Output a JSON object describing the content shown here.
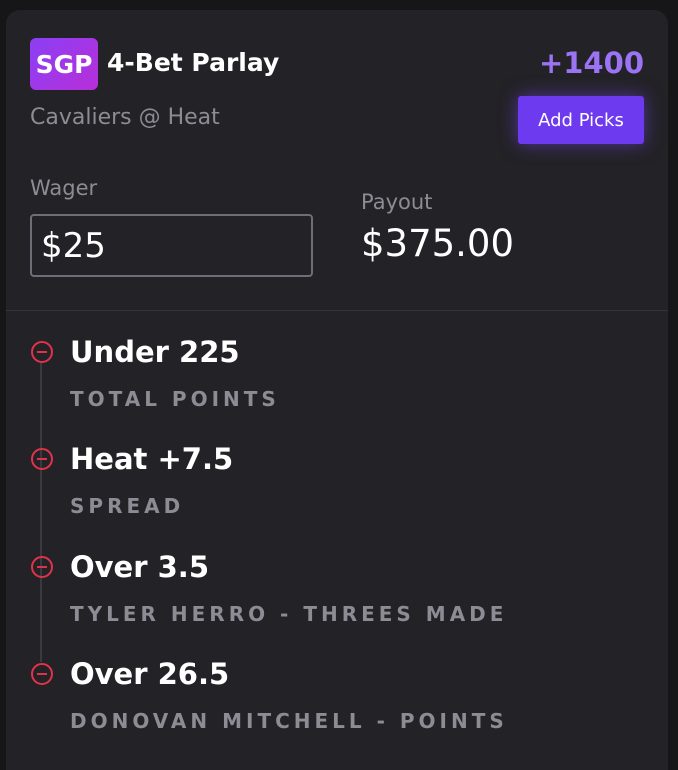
{
  "bet": {
    "badge": "SGP",
    "title": "4-Bet Parlay",
    "matchup": "Cavaliers @ Heat",
    "odds": "+1400",
    "add_picks_label": "Add Picks"
  },
  "wager": {
    "label": "Wager",
    "value": "$25"
  },
  "payout": {
    "label": "Payout",
    "value": "$375.00"
  },
  "picks": [
    {
      "title": "Under 225",
      "market": "TOTAL POINTS"
    },
    {
      "title": "Heat +7.5",
      "market": "SPREAD"
    },
    {
      "title": "Over 3.5",
      "market": "TYLER HERRO - THREES MADE"
    },
    {
      "title": "Over 26.5",
      "market": "DONOVAN MITCHELL - POINTS"
    }
  ],
  "colors": {
    "accent": "#6d3af0",
    "odds": "#9a74f5",
    "remove": "#e0334a"
  },
  "icons": {
    "remove": "minus-circle-icon"
  }
}
